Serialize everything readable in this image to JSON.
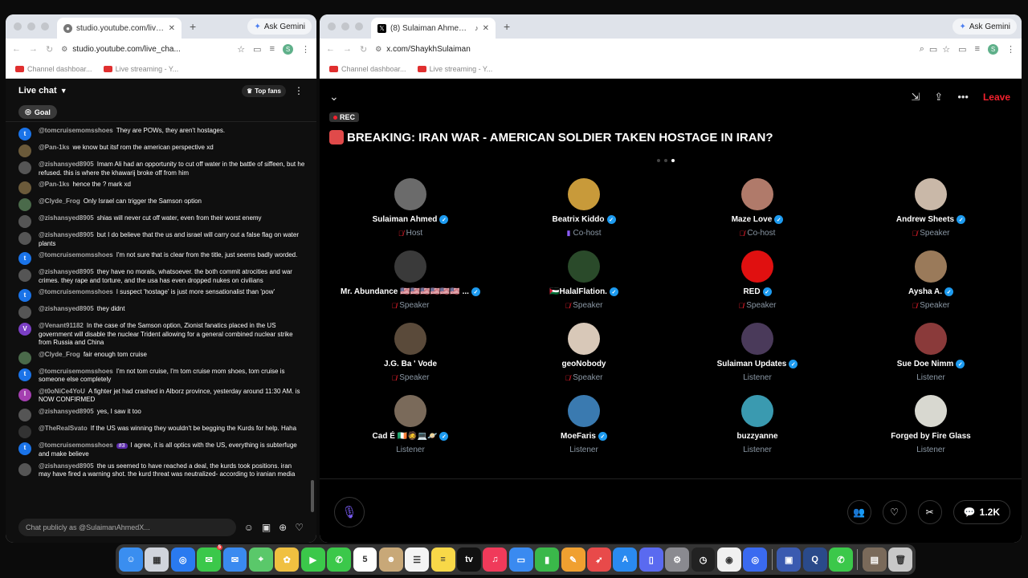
{
  "left_browser": {
    "tab_title": "studio.youtube.com/live_chat",
    "gemini_label": "Ask Gemini",
    "url": "studio.youtube.com/live_cha...",
    "bookmarks": [
      "Channel dashboar...",
      "Live streaming - Y..."
    ]
  },
  "right_browser": {
    "tab_title": "(8) Sulaiman Ahmed (@S...",
    "gemini_label": "Ask Gemini",
    "url": "x.com/ShaykhSulaiman",
    "bookmarks": [
      "Channel dashboar...",
      "Live streaming - Y..."
    ]
  },
  "chat": {
    "title": "Live chat",
    "top_fans": "Top fans",
    "goal": "Goal",
    "input_placeholder": "Chat publicly as @SulaimanAhmedX...",
    "messages": [
      {
        "author": "@tomcruisemomsshoes",
        "text": "They are POWs, they aren't hostages.",
        "color": "#1a73e8",
        "initial": "t"
      },
      {
        "author": "@Pan-1ks",
        "text": "we know but itsf rom the american perspective xd",
        "color": "#6b5a3a",
        "initial": ""
      },
      {
        "author": "@zishansyed8905",
        "text": "Imam Ali had an opportunity to cut off water in the battle of siffeen, but he refused. this is where the khawarij broke off from him",
        "color": "#555",
        "initial": ""
      },
      {
        "author": "@Pan-1ks",
        "text": "hence the ? mark xd",
        "color": "#6b5a3a",
        "initial": ""
      },
      {
        "author": "@Clyde_Frog",
        "text": "Only Israel can trigger the Samson option",
        "color": "#4a6a4a",
        "initial": ""
      },
      {
        "author": "@zishansyed8905",
        "text": "shias will never cut off water, even from their worst enemy",
        "color": "#555",
        "initial": ""
      },
      {
        "author": "@zishansyed8905",
        "text": "but I do believe that the us and israel will carry out a false flag on water plants",
        "color": "#555",
        "initial": ""
      },
      {
        "author": "@tomcruisemomsshoes",
        "text": "I'm not sure that is clear from the title, just seems badly worded.",
        "color": "#1a73e8",
        "initial": "t"
      },
      {
        "author": "@zishansyed8905",
        "text": "they have no morals, whatsoever. the both commit atrocities and war crimes. they rape and torture, and the usa has even dropped nukes on civilians",
        "color": "#555",
        "initial": ""
      },
      {
        "author": "@tomcruisemomsshoes",
        "text": "I suspect 'hostage' is just more sensationalist than 'pow'",
        "color": "#1a73e8",
        "initial": "t"
      },
      {
        "author": "@zishansyed8905",
        "text": "they didnt",
        "color": "#555",
        "initial": ""
      },
      {
        "author": "@Venant91182",
        "text": "In the case of the Samson option, Zionist fanatics placed in the US government will disable the nuclear Trident allowing for a general combined nuclear strike from Russia and China",
        "color": "#7b3fc4",
        "initial": "V"
      },
      {
        "author": "@Clyde_Frog",
        "text": "fair enough tom cruise",
        "color": "#4a6a4a",
        "initial": ""
      },
      {
        "author": "@tomcruisemomsshoes",
        "text": "I'm not tom cruise, I'm tom cruise mom shoes, tom cruise is someone else completely",
        "color": "#1a73e8",
        "initial": "t"
      },
      {
        "author": "@t0oNiCe4YoU",
        "text": "A fighter jet had crashed in Alborz province, yesterday around 11:30 AM. is NOW CONFIRMED",
        "color": "#a43fb0",
        "initial": "I"
      },
      {
        "author": "@zishansyed8905",
        "text": "yes, I saw it too",
        "color": "#555",
        "initial": ""
      },
      {
        "author": "@TheRealSvato",
        "text": "If the US was winning they wouldn't be begging the Kurds for help. Haha",
        "color": "#333",
        "initial": ""
      },
      {
        "author": "@tomcruisemomsshoes",
        "text": "I agree, it is all optics with the US, everything is subterfuge and make believe",
        "color": "#1a73e8",
        "initial": "t",
        "badge": "#3"
      },
      {
        "author": "@zishansyed8905",
        "text": "the us seemed to have reached a deal, the kurds took positions. iran may have fired a warning shot. the kurd threat was neutralized- according to iranian media",
        "color": "#555",
        "initial": ""
      }
    ]
  },
  "space": {
    "leave_label": "Leave",
    "rec_label": "REC",
    "title": "BREAKING: IRAN WAR - AMERICAN SOLDIER TAKEN HOSTAGE IN IRAN?",
    "participants": [
      {
        "name": "Sulaiman Ahmed",
        "role": "Host",
        "verified": true,
        "mic": "muted",
        "color": "#6b6b6b"
      },
      {
        "name": "Beatrix Kiddo",
        "role": "Co-host",
        "verified": true,
        "mic": "talking",
        "color": "#c89a3a"
      },
      {
        "name": "Maze Love",
        "role": "Co-host",
        "verified": true,
        "mic": "muted",
        "color": "#b07a6a"
      },
      {
        "name": "Andrew Sheets",
        "role": "Speaker",
        "verified": true,
        "mic": "muted",
        "color": "#c9b8a8"
      },
      {
        "name": "Mr. Abundance 🇺🇸🇺🇸🇺🇸🇺🇸🇺🇸🇺🇸 ...",
        "role": "Speaker",
        "verified": true,
        "mic": "muted",
        "color": "#3a3a3a"
      },
      {
        "name": "🇵🇸HalalFlation.",
        "role": "Speaker",
        "verified": true,
        "mic": "muted",
        "color": "#2a4a2a"
      },
      {
        "name": "RED",
        "role": "Speaker",
        "verified": true,
        "mic": "muted",
        "color": "#e01010"
      },
      {
        "name": "Aysha A.",
        "role": "Speaker",
        "verified": true,
        "mic": "muted",
        "color": "#9a7a5a"
      },
      {
        "name": "J.G. Ba ' Vode",
        "role": "Speaker",
        "verified": false,
        "mic": "muted",
        "color": "#5a4a3a"
      },
      {
        "name": "geoNobody",
        "role": "Speaker",
        "verified": false,
        "mic": "muted",
        "color": "#d8c8b8"
      },
      {
        "name": "Sulaiman Updates",
        "role": "Listener",
        "verified": true,
        "mic": "none",
        "color": "#4a3a5a"
      },
      {
        "name": "Sue Doe Nimm",
        "role": "Listener",
        "verified": true,
        "mic": "none",
        "color": "#8a3a3a"
      },
      {
        "name": "Cad É 🇮🇪🧔💻🪐",
        "role": "Listener",
        "verified": true,
        "mic": "none",
        "color": "#7a6a5a"
      },
      {
        "name": "MoeFaris",
        "role": "Listener",
        "verified": true,
        "mic": "none",
        "color": "#3a7ab0"
      },
      {
        "name": "buzzyanne",
        "role": "Listener",
        "verified": false,
        "mic": "none",
        "color": "#3a9ab0"
      },
      {
        "name": "Forged by Fire Glass",
        "role": "Listener",
        "verified": false,
        "mic": "none",
        "color": "#d8d8d0"
      }
    ],
    "reply_count": "1.2K"
  },
  "dock": [
    {
      "name": "finder-icon",
      "color": "#3a8ef0",
      "glyph": "☺"
    },
    {
      "name": "launchpad-icon",
      "color": "#d0d4dc",
      "glyph": "▦"
    },
    {
      "name": "safari-icon",
      "color": "#2a7af0",
      "glyph": "◎"
    },
    {
      "name": "messages-icon",
      "color": "#3bc84a",
      "glyph": "✉",
      "badge": "5"
    },
    {
      "name": "mail-icon",
      "color": "#3a8af0",
      "glyph": "✉"
    },
    {
      "name": "maps-icon",
      "color": "#5ac86a",
      "glyph": "⌖"
    },
    {
      "name": "photos-icon",
      "color": "#f0c040",
      "glyph": "✿"
    },
    {
      "name": "facetime-icon",
      "color": "#3bc84a",
      "glyph": "▶"
    },
    {
      "name": "phone-icon",
      "color": "#3bc84a",
      "glyph": "✆"
    },
    {
      "name": "calendar-icon",
      "color": "#ffffff",
      "glyph": "5"
    },
    {
      "name": "contacts-icon",
      "color": "#c8a878",
      "glyph": "☻"
    },
    {
      "name": "reminders-icon",
      "color": "#f4f4f4",
      "glyph": "☰"
    },
    {
      "name": "notes-icon",
      "color": "#f8d848",
      "glyph": "≡"
    },
    {
      "name": "tv-icon",
      "color": "#111111",
      "glyph": "tv"
    },
    {
      "name": "music-icon",
      "color": "#f03a5a",
      "glyph": "♫"
    },
    {
      "name": "keynote-icon",
      "color": "#3a8af0",
      "glyph": "▭"
    },
    {
      "name": "numbers-icon",
      "color": "#3ab84a",
      "glyph": "▮"
    },
    {
      "name": "pages-icon",
      "color": "#f0a030",
      "glyph": "✎"
    },
    {
      "name": "rocket-icon",
      "color": "#e84a4a",
      "glyph": "➶"
    },
    {
      "name": "appstore-icon",
      "color": "#2a8af0",
      "glyph": "A"
    },
    {
      "name": "iphone-mirroring-icon",
      "color": "#5a6af0",
      "glyph": "▯"
    },
    {
      "name": "settings-icon",
      "color": "#8a8a90",
      "glyph": "⚙"
    },
    {
      "name": "clock-icon",
      "color": "#222222",
      "glyph": "◷"
    },
    {
      "name": "chrome-icon",
      "color": "#f0f0f0",
      "glyph": "◉"
    },
    {
      "name": "safari-tech-icon",
      "color": "#3a6af0",
      "glyph": "◎"
    },
    {
      "name": "sep",
      "color": "",
      "glyph": ""
    },
    {
      "name": "preview-icon",
      "color": "#3a5ab0",
      "glyph": "▣"
    },
    {
      "name": "quicktime-icon",
      "color": "#2a4a8a",
      "glyph": "Q"
    },
    {
      "name": "whatsapp-icon",
      "color": "#3bc84a",
      "glyph": "✆"
    },
    {
      "name": "sep",
      "color": "",
      "glyph": ""
    },
    {
      "name": "downloads-icon",
      "color": "#7a6a5a",
      "glyph": "▤"
    },
    {
      "name": "trash-icon",
      "color": "#c8c8c8",
      "glyph": "🗑"
    }
  ]
}
